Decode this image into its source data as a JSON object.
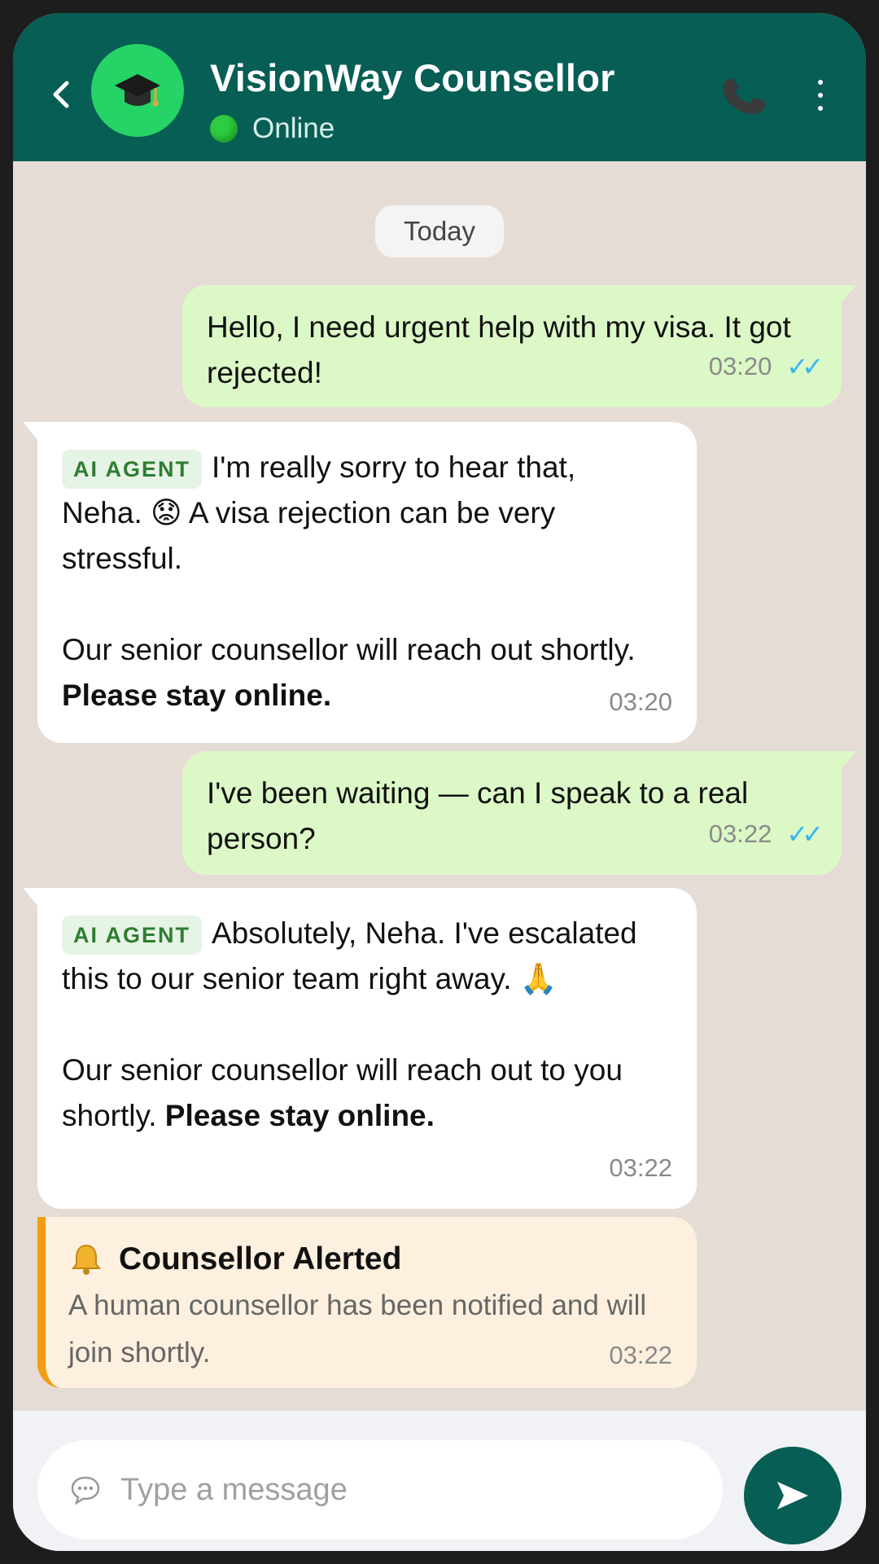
{
  "header": {
    "title": "VisionWay Counsellor",
    "status": "Online",
    "avatar_icon": "graduation-cap-icon",
    "status_color": "#2ecc40",
    "bar_color": "#075e54"
  },
  "chat": {
    "date_label": "Today",
    "messages": [
      {
        "direction": "outgoing",
        "text": "Hello, I need urgent help with my visa. It got rejected!",
        "time": "03:20",
        "ticks": "✓✓"
      },
      {
        "direction": "incoming",
        "badge": "AI AGENT",
        "line1": "I'm really sorry to hear that, Neha.",
        "emoji": "😟",
        "line1_rest": "A visa rejection can be very stressful.",
        "para2_normal": "Our senior counsellor will reach out shortly.",
        "para2_bold": "Please stay online.",
        "time": "03:20"
      },
      {
        "direction": "outgoing",
        "text": "I've been waiting — can I speak to a real person?",
        "time": "03:22",
        "ticks": "✓✓"
      },
      {
        "direction": "incoming",
        "badge": "AI AGENT",
        "line1": "Absolutely, Neha. I've escalated this to our senior team right away.",
        "emoji": "🙏",
        "para2_normal": "Our senior counsellor will reach out to you shortly.",
        "para2_bold": "Please stay online.",
        "time": "03:22"
      }
    ],
    "alert": {
      "icon": "bell-icon",
      "title": "Counsellor Alerted",
      "body": "A human counsellor has been notified and will join shortly.",
      "time": "03:22"
    }
  },
  "composer": {
    "placeholder": "Type a message",
    "send_icon": "send-icon"
  }
}
